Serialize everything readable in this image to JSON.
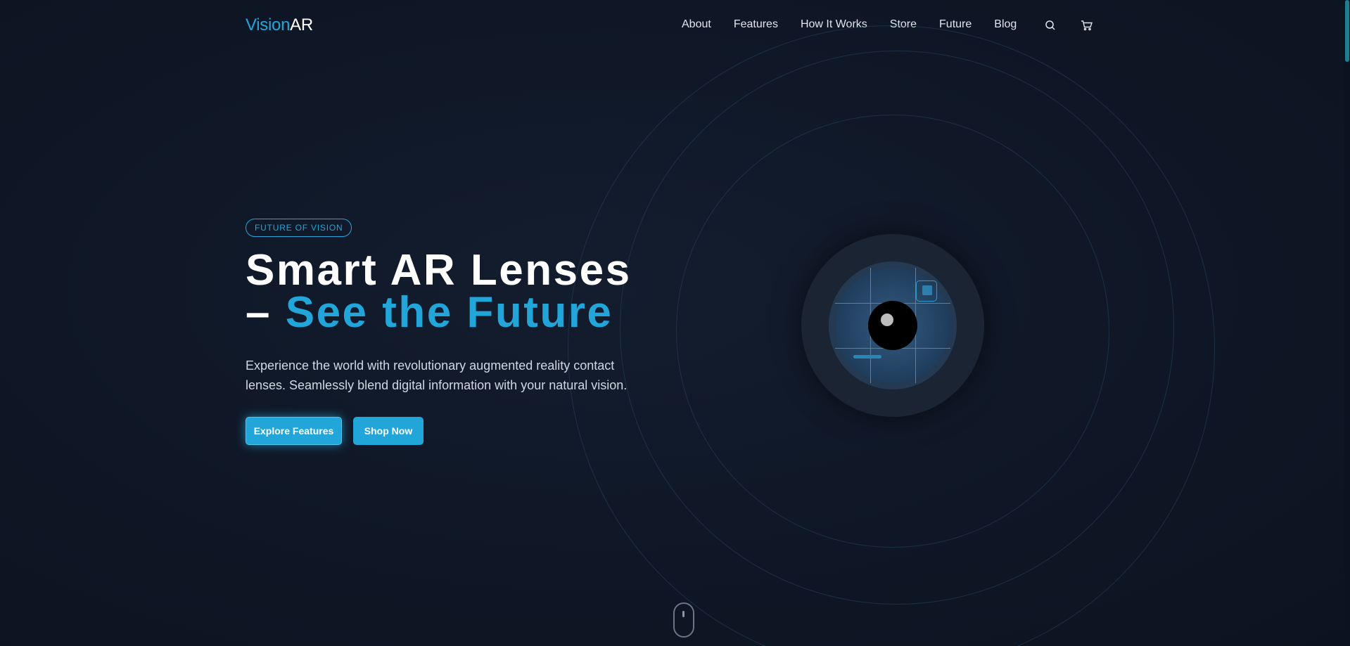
{
  "nav": {
    "logo_part1": "Vision",
    "logo_part2": "AR",
    "links": [
      "About",
      "Features",
      "How It Works",
      "Store",
      "Future",
      "Blog"
    ],
    "icons": [
      "search-icon",
      "cart-icon"
    ]
  },
  "hero": {
    "badge": "FUTURE OF VISION",
    "headline_line1": "Smart AR Lenses",
    "headline_dash": "– ",
    "headline_accent": "See the Future",
    "description": "Experience the world with revolutionary augmented reality contact lenses. Seamlessly blend digital information with your natural vision.",
    "primary_button": "Explore Features",
    "secondary_button": "Shop Now"
  },
  "colors": {
    "accent": "#22a6d9",
    "background": "#0f1726",
    "text": "#ffffff"
  }
}
